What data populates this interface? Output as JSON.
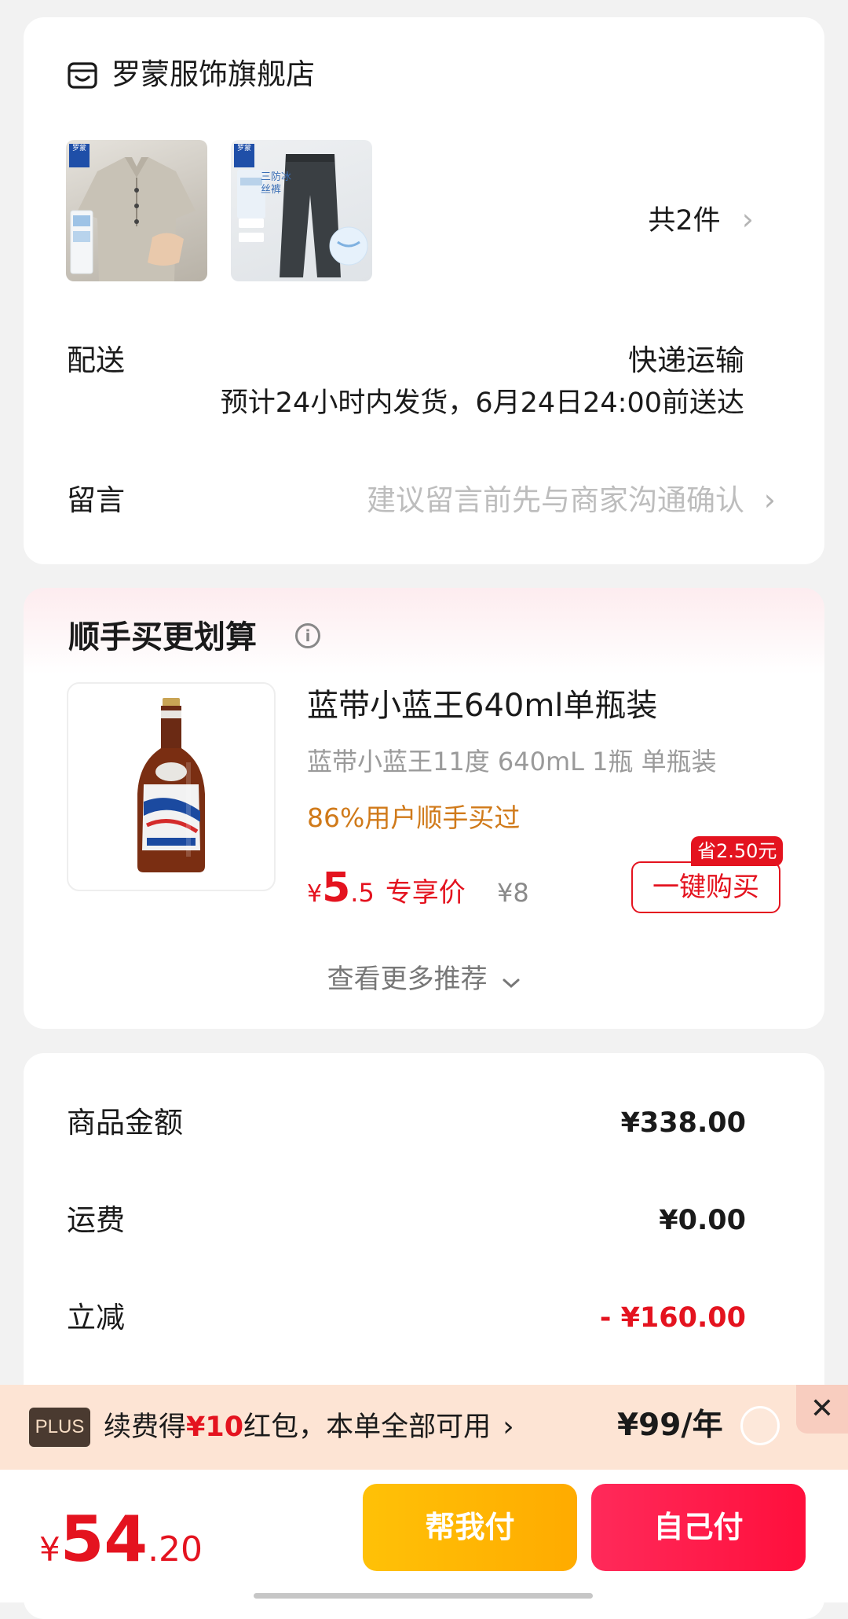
{
  "store": {
    "name": "罗蒙服饰旗舰店",
    "icon": "store-icon"
  },
  "items": {
    "thumbnails": [
      {
        "brand_tag": "罗蒙",
        "kind": "polo-shirt"
      },
      {
        "brand_tag": "罗蒙",
        "kind": "pants",
        "overlay_text": "三防冰丝裤"
      }
    ],
    "count_label": "共2件"
  },
  "delivery": {
    "label": "配送",
    "method": "快递运输",
    "eta": "预计24小时内发货，6月24日24:00前送达"
  },
  "message": {
    "label": "留言",
    "placeholder": "建议留言前先与商家沟通确认"
  },
  "recommend": {
    "title": "顺手买更划算",
    "product": {
      "name": "蓝带小蓝王640ml单瓶装",
      "spec": "蓝带小蓝王11度 640mL 1瓶 单瓶装",
      "popularity": "86%用户顺手买过",
      "price_symbol": "¥",
      "price_int": "5",
      "price_dec": ".5",
      "price_label": "专享价",
      "original_price": "¥8",
      "save_badge": "省2.50元",
      "buy_label": "一键购买"
    },
    "more_label": "查看更多推荐"
  },
  "summary": [
    {
      "label": "商品金额",
      "value": "¥338.00"
    },
    {
      "label": "运费",
      "value": "¥0.00"
    },
    {
      "label": "立减",
      "value": "- ¥160.00"
    }
  ],
  "plus": {
    "badge": "PLUS",
    "text_pre": "续费得",
    "text_amount": "¥10",
    "text_post": "红包，本单全部可用",
    "price": "¥99/年"
  },
  "checkout": {
    "total_symbol": "¥",
    "total_int": "54",
    "total_dec": ".20",
    "help_pay_label": "帮我付",
    "self_pay_label": "自己付"
  },
  "colors": {
    "accent_red": "#e4131f",
    "help_pay": "#ffb300",
    "self_pay": "#ff1f4b",
    "popularity": "#d07a1a"
  }
}
